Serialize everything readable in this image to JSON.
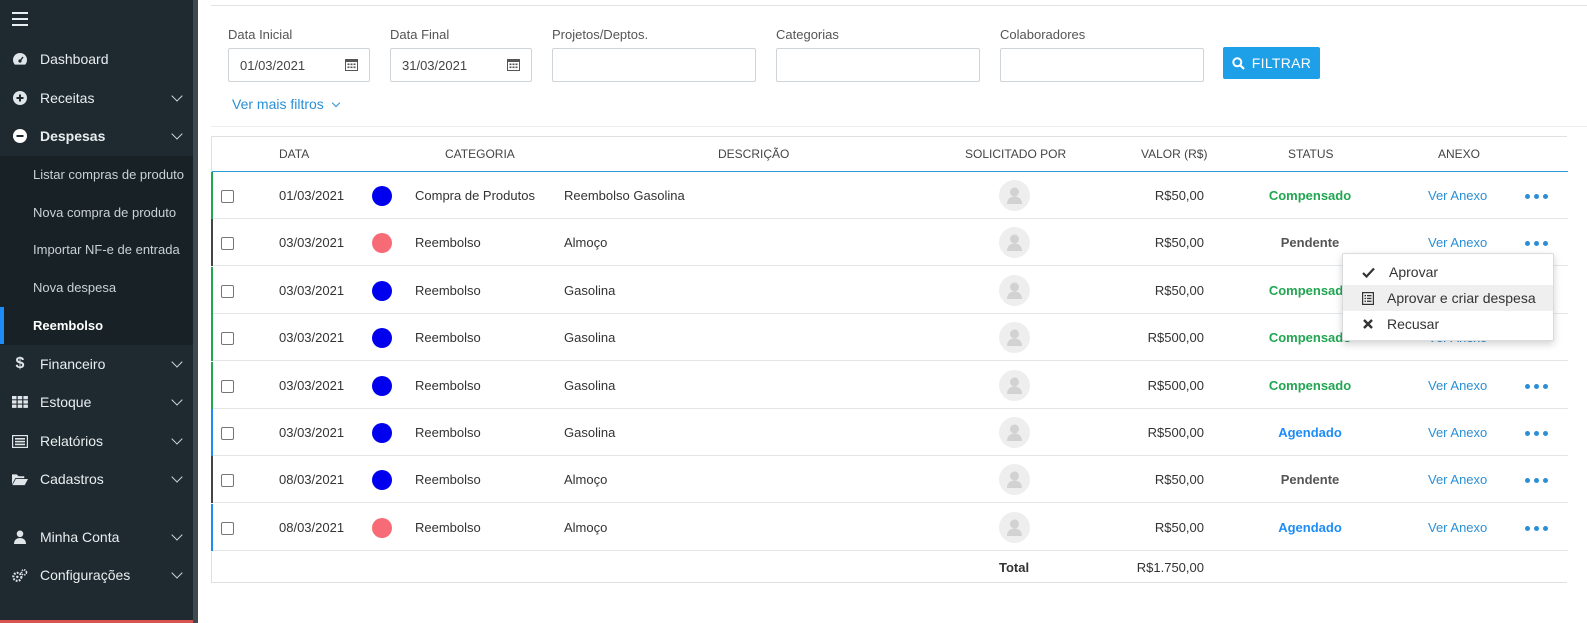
{
  "sidebar": {
    "items": [
      {
        "label": "Dashboard",
        "icon": "dashboard-icon"
      },
      {
        "label": "Receitas",
        "icon": "plus-circle-icon"
      },
      {
        "label": "Despesas",
        "icon": "minus-circle-icon"
      },
      {
        "label": "Financeiro",
        "icon": "dollar-icon"
      },
      {
        "label": "Estoque",
        "icon": "grid-icon"
      },
      {
        "label": "Relatórios",
        "icon": "report-icon"
      },
      {
        "label": "Cadastros",
        "icon": "folder-open-icon"
      },
      {
        "label": "Minha Conta",
        "icon": "user-icon"
      },
      {
        "label": "Configurações",
        "icon": "gears-icon"
      }
    ],
    "submenu": [
      "Listar compras de produto",
      "Nova compra de produto",
      "Importar NF-e de entrada",
      "Nova despesa",
      "Reembolso"
    ],
    "active_submenu": "Reembolso"
  },
  "filters": {
    "data_inicial_label": "Data Inicial",
    "data_inicial_value": "01/03/2021",
    "data_final_label": "Data Final",
    "data_final_value": "31/03/2021",
    "projetos_label": "Projetos/Deptos.",
    "categorias_label": "Categorias",
    "colaboradores_label": "Colaboradores",
    "filter_button": "FILTRAR",
    "more_filters": "Ver mais filtros"
  },
  "table": {
    "headers": {
      "data": "DATA",
      "categoria": "CATEGORIA",
      "descricao": "DESCRIÇÃO",
      "solicitado": "SOLICITADO POR",
      "valor": "VALOR (R$)",
      "status": "STATUS",
      "anexo": "ANEXO"
    },
    "rows": [
      {
        "data": "01/03/2021",
        "categoria": "Compra de Produtos",
        "descricao": "Reembolso Gasolina",
        "valor": "R$50,00",
        "status": "Compensado",
        "anexo": "Ver Anexo",
        "dot_color": "#0000ee"
      },
      {
        "data": "03/03/2021",
        "categoria": "Reembolso",
        "descricao": "Almoço",
        "valor": "R$50,00",
        "status": "Pendente",
        "anexo": "Ver Anexo",
        "dot_color": "#f76b76"
      },
      {
        "data": "03/03/2021",
        "categoria": "Reembolso",
        "descricao": "Gasolina",
        "valor": "R$50,00",
        "status": "Compensado",
        "anexo": "Ver Anexo",
        "dot_color": "#0000ee"
      },
      {
        "data": "03/03/2021",
        "categoria": "Reembolso",
        "descricao": "Gasolina",
        "valor": "R$500,00",
        "status": "Compensado",
        "anexo": "Ver Anexo",
        "dot_color": "#0000ee"
      },
      {
        "data": "03/03/2021",
        "categoria": "Reembolso",
        "descricao": "Gasolina",
        "valor": "R$500,00",
        "status": "Compensado",
        "anexo": "Ver Anexo",
        "dot_color": "#0000ee"
      },
      {
        "data": "03/03/2021",
        "categoria": "Reembolso",
        "descricao": "Gasolina",
        "valor": "R$500,00",
        "status": "Agendado",
        "anexo": "Ver Anexo",
        "dot_color": "#0000ee"
      },
      {
        "data": "08/03/2021",
        "categoria": "Reembolso",
        "descricao": "Almoço",
        "valor": "R$50,00",
        "status": "Pendente",
        "anexo": "Ver Anexo",
        "dot_color": "#0000ee"
      },
      {
        "data": "08/03/2021",
        "categoria": "Reembolso",
        "descricao": "Almoço",
        "valor": "R$50,00",
        "status": "Agendado",
        "anexo": "Ver Anexo",
        "dot_color": "#f76b76"
      }
    ],
    "total_label": "Total",
    "total_value": "R$1.750,00"
  },
  "status_colors": {
    "Compensado": "#21a651",
    "Pendente": "#555555",
    "Agendado": "#1d8cf8"
  },
  "dropdown": {
    "items": [
      {
        "label": "Aprovar",
        "icon": "check-icon"
      },
      {
        "label": "Aprovar e criar despesa",
        "icon": "list-document-icon"
      },
      {
        "label": "Recusar",
        "icon": "close-icon"
      }
    ]
  }
}
